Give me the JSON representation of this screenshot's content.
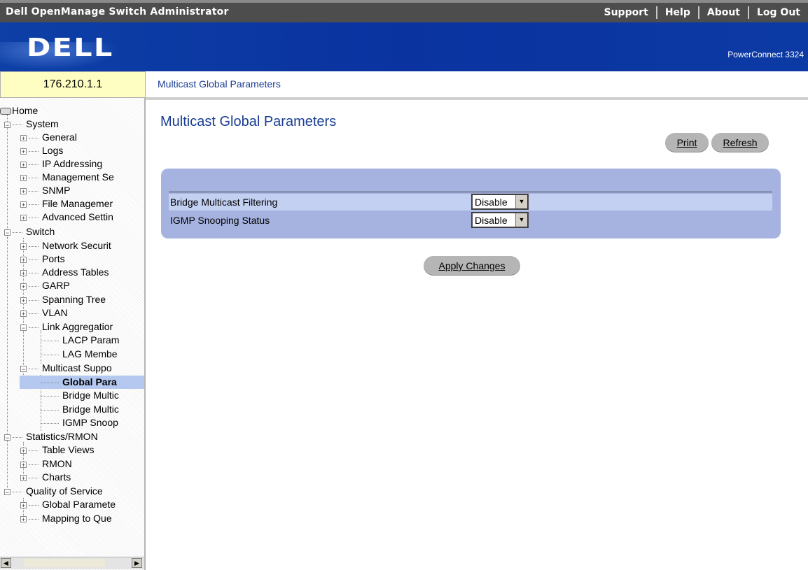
{
  "app": {
    "title": "Dell OpenManage Switch Administrator",
    "logo": "DELL",
    "model": "PowerConnect 3324"
  },
  "toplinks": [
    "Support",
    "Help",
    "About",
    "Log Out"
  ],
  "ip": "176.210.1.1",
  "breadcrumb": "Multicast Global Parameters",
  "page": {
    "title": "Multicast Global Parameters",
    "print_label": "Print",
    "refresh_label": "Refresh",
    "apply_label": "Apply Changes"
  },
  "form": {
    "rows": [
      {
        "label": "Bridge Multicast Filtering",
        "value": "Disable"
      },
      {
        "label": "IGMP Snooping Status",
        "value": "Disable"
      }
    ]
  },
  "tree": [
    {
      "label": "Home"
    },
    {
      "label": "System"
    },
    {
      "label": "General"
    },
    {
      "label": "Logs"
    },
    {
      "label": "IP Addressing"
    },
    {
      "label": "Management Se"
    },
    {
      "label": "SNMP"
    },
    {
      "label": "File Managemer"
    },
    {
      "label": "Advanced Settin"
    },
    {
      "label": "Switch"
    },
    {
      "label": "Network Securit"
    },
    {
      "label": "Ports"
    },
    {
      "label": "Address Tables"
    },
    {
      "label": "GARP"
    },
    {
      "label": "Spanning Tree"
    },
    {
      "label": "VLAN"
    },
    {
      "label": "Link Aggregatior"
    },
    {
      "label": "LACP Param"
    },
    {
      "label": "LAG Membe"
    },
    {
      "label": "Multicast Suppo"
    },
    {
      "label": "Global Para"
    },
    {
      "label": "Bridge Multic"
    },
    {
      "label": "Bridge Multic"
    },
    {
      "label": "IGMP Snoop"
    },
    {
      "label": "Statistics/RMON"
    },
    {
      "label": "Table Views"
    },
    {
      "label": "RMON"
    },
    {
      "label": "Charts"
    },
    {
      "label": "Quality of Service"
    },
    {
      "label": "Global Paramete"
    },
    {
      "label": "Mapping to Que"
    }
  ],
  "colors": {
    "accent": "#1a3d94",
    "banner": "#0a3aa8",
    "selected": "#b4c8f0",
    "panel": "#a6b3e0"
  }
}
